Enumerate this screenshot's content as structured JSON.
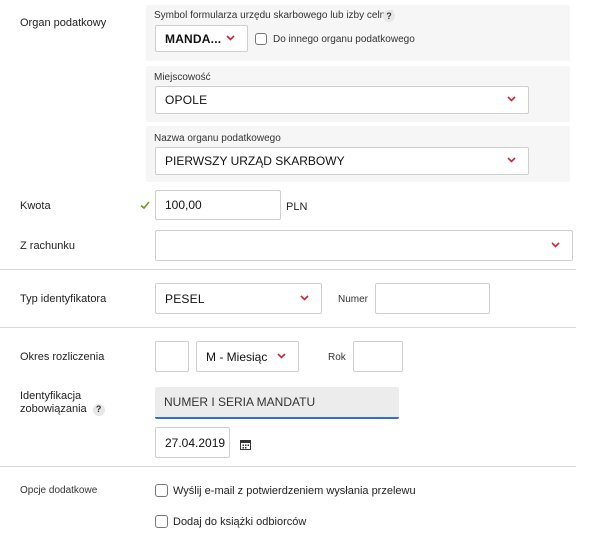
{
  "organ": {
    "label": "Organ podatkowy",
    "symbol_label": "Symbol formularza urzędu skarbowego lub izby celnej",
    "symbol_value": "MANDA...",
    "other_organ_label": "Do innego organu podatkowego",
    "city_label": "Miejscowość",
    "city_value": "OPOLE",
    "office_label": "Nazwa organu podatkowego",
    "office_value": "PIERWSZY URZĄD SKARBOWY"
  },
  "amount": {
    "label": "Kwota",
    "value": "100,00",
    "currency": "PLN"
  },
  "account": {
    "label": "Z rachunku",
    "value": ""
  },
  "identifier": {
    "label": "Typ identyfikatora",
    "type_value": "PESEL",
    "number_label": "Numer",
    "number_value": ""
  },
  "period": {
    "label": "Okres rozliczenia",
    "day_value": "",
    "month_value": "M - Miesiąc",
    "year_label": "Rok",
    "year_value": ""
  },
  "obligation": {
    "label_line1": "Identyfikacja",
    "label_line2": "zobowiązania",
    "value": "NUMER I SERIA MANDATU",
    "date_value": "27.04.2019"
  },
  "options": {
    "label": "Opcje dodatkowe",
    "email_label": "Wyślij e-mail z potwierdzeniem wysłania przelewu",
    "addressbook_label": "Dodaj do książki odbiorców"
  },
  "help_glyph": "?",
  "colors": {
    "chevron": "#d0243b",
    "check": "#6a9a1f",
    "focus": "#2f6fd0"
  },
  "icons": [
    "chevron-down-icon",
    "help-icon",
    "check-icon",
    "calendar-icon"
  ]
}
